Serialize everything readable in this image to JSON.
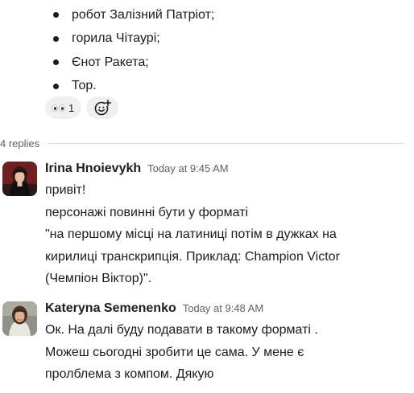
{
  "bullets": [
    "робот Залізний Патріот;",
    "горила Чітаурі;",
    "Єнот Ракета;",
    "Тор."
  ],
  "reaction": {
    "emoji_name": "eyes-emoji",
    "count": "1"
  },
  "add_reaction_icon": "add-reaction-icon",
  "replies_label": "4 replies",
  "messages": [
    {
      "author": "Irina Hnoievykh",
      "time": "Today at 9:45 AM",
      "lines": [
        "привіт!",
        "персонажі повинні бути у форматі",
        "\"на першому місці на латиниці потім в дужках на",
        "кирилиці транскрипція. Приклад: Champion Victor",
        "(Чемпіон Віктор)\"."
      ]
    },
    {
      "author": "Kateryna Semenenko",
      "time": "Today at 9:48 AM",
      "lines": [
        "Ок. На далі буду подавати в такому форматі .",
        "Можеш сьогодні зробити це сама. У мене є",
        "пролблема з компом. Дякую"
      ]
    }
  ],
  "colors": {
    "text": "#1d1c1d",
    "muted": "#616061",
    "pill_bg": "#f0f0f0",
    "divider": "#dddddd"
  }
}
